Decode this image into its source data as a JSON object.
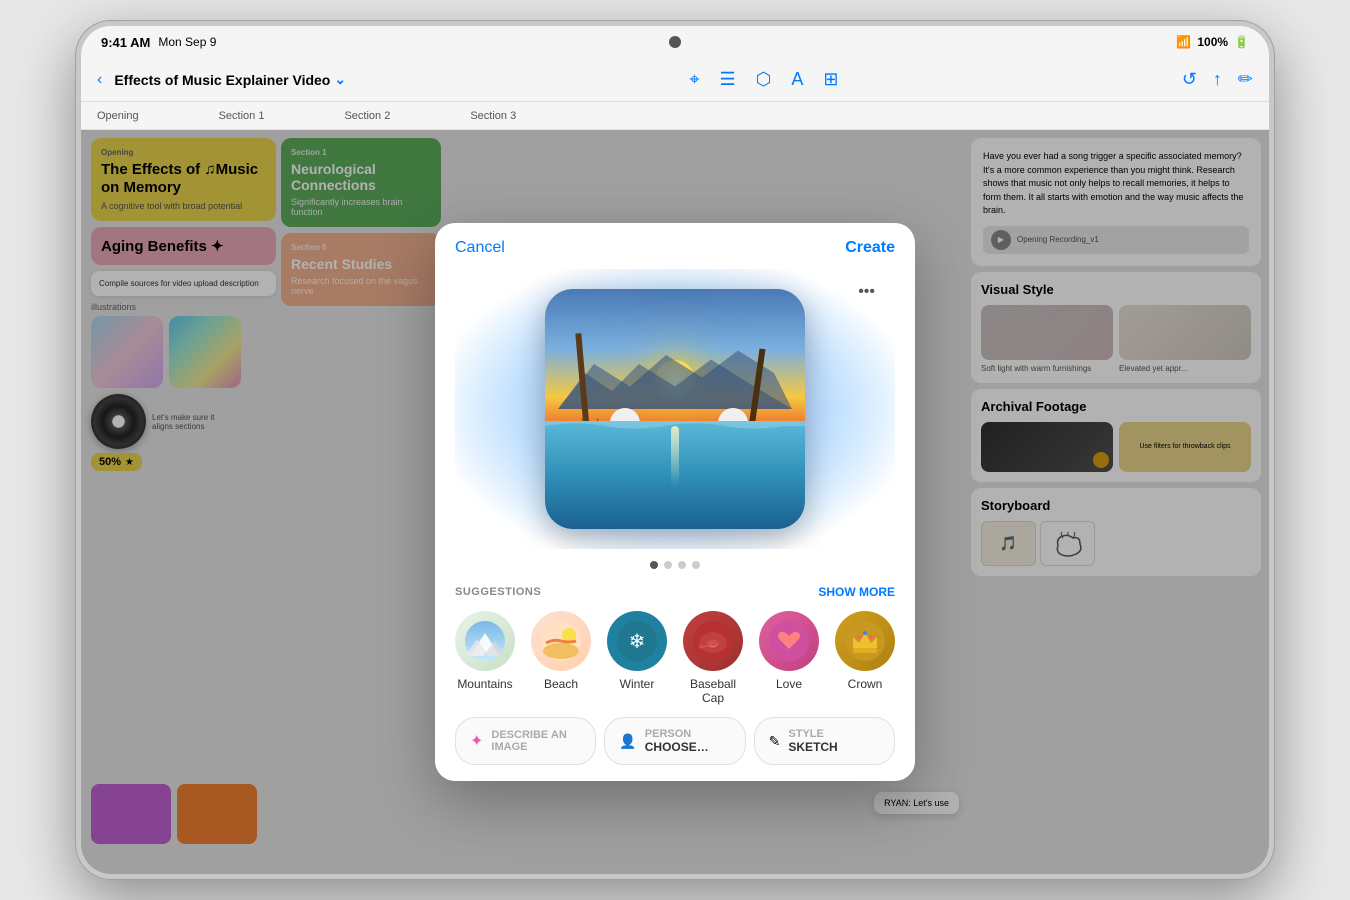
{
  "device": {
    "time": "9:41 AM",
    "date": "Mon Sep 9",
    "battery": "100%",
    "wifi": true
  },
  "toolbar": {
    "back_label": "‹",
    "title": "Effects of Music Explainer Video",
    "chevron": "⌄",
    "icons": [
      "↑",
      "▤",
      "⬡",
      "A",
      "⊞"
    ]
  },
  "sections": {
    "labels": [
      "Opening",
      "Section 1",
      "Section 2",
      "Section 3"
    ]
  },
  "background_cards": {
    "opening_title": "The Effects of ♫Music on Memory",
    "opening_subtitle": "A cognitive tool with broad potential",
    "section1_title": "Neurological Connections",
    "section1_subtitle": "Significantly increases brain function",
    "section4_title": "Aging Benefits ✦",
    "section5_title": "Recent Studies",
    "section5_subtitle": "Research focused on the vagus nerve",
    "percent": "50%"
  },
  "right_panel": {
    "question": "Have you ever had a song trigger a specific associated memory? It's a more common experience than you might think. Research shows that music not only helps to recall memories, it helps to form them. It all starts with emotion and the way music affects the brain.",
    "visual_style_title": "Visual Style",
    "visual_style_caption1": "Soft light with warm furnishings",
    "visual_style_caption2": "Elevated yet appr...",
    "archival_title": "Archival Footage",
    "archival_caption": "Use filters for throwback clips",
    "storyboard_title": "Storyboard"
  },
  "modal": {
    "cancel_label": "Cancel",
    "create_label": "Create",
    "more_icon": "•••",
    "image_description": "AI generated sunset pool scene with palm trees",
    "page_dots": [
      true,
      false,
      false,
      false
    ],
    "suggestions_label": "SUGGESTIONS",
    "show_more_label": "SHOW MORE",
    "suggestions": [
      {
        "id": "mountains",
        "label": "Mountains",
        "emoji": "⛰️"
      },
      {
        "id": "beach",
        "label": "Beach",
        "emoji": "🏖️"
      },
      {
        "id": "winter",
        "label": "Winter",
        "emoji": "❄️"
      },
      {
        "id": "baseball-cap",
        "label": "Baseball Cap",
        "emoji": "🎩"
      },
      {
        "id": "love",
        "label": "Love",
        "emoji": "❤️"
      },
      {
        "id": "crown",
        "label": "Crown",
        "emoji": "👑"
      }
    ],
    "inputs": [
      {
        "id": "describe",
        "icon": "✦",
        "label": "DESCRIBE AN IMAGE",
        "value": ""
      },
      {
        "id": "person",
        "icon": "👤",
        "label": "PERSON",
        "value": "CHOOSE…"
      },
      {
        "id": "style",
        "icon": "✎",
        "label": "STYLE",
        "value": "SKETCH"
      }
    ]
  }
}
